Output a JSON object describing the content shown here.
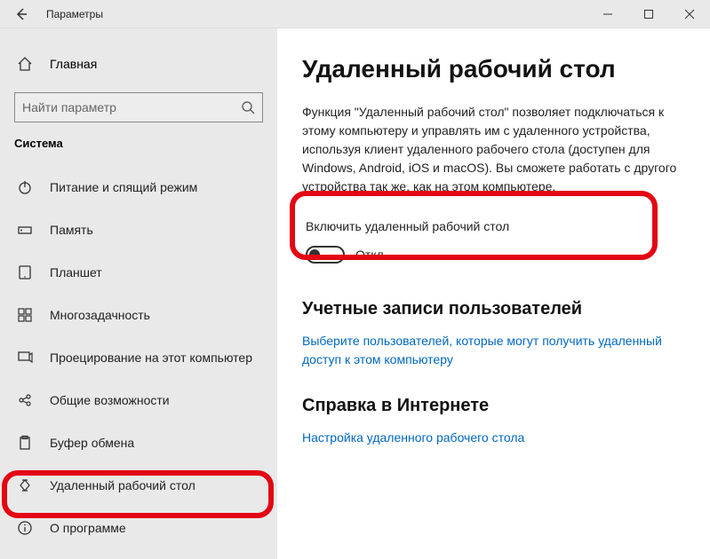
{
  "titlebar": {
    "title": "Параметры"
  },
  "sidebar": {
    "home_label": "Главная",
    "search_placeholder": "Найти параметр",
    "category_label": "Система",
    "items": [
      {
        "icon": "power-icon",
        "label": "Питание и спящий режим"
      },
      {
        "icon": "storage-icon",
        "label": "Память"
      },
      {
        "icon": "tablet-icon",
        "label": "Планшет"
      },
      {
        "icon": "multitask-icon",
        "label": "Многозадачность"
      },
      {
        "icon": "project-icon",
        "label": "Проецирование на этот компьютер"
      },
      {
        "icon": "shared-icon",
        "label": "Общие возможности"
      },
      {
        "icon": "clipboard-icon",
        "label": "Буфер обмена"
      },
      {
        "icon": "remote-icon",
        "label": "Удаленный рабочий стол"
      },
      {
        "icon": "about-icon",
        "label": "О программе"
      }
    ]
  },
  "content": {
    "heading": "Удаленный рабочий стол",
    "description": "Функция \"Удаленный рабочий стол\" позволяет подключаться к этому компьютеру и управлять им с удаленного устройства, используя клиент удаленного рабочего стола (доступен для Windows, Android, iOS и macOS). Вы сможете работать с другого устройства так же, как на этом компьютере.",
    "toggle_label": "Включить удаленный рабочий стол",
    "toggle_state": "Откл.",
    "accounts_heading": "Учетные записи пользователей",
    "accounts_link": "Выберите пользователей, которые могут получить удаленный доступ к этом компьютеру",
    "help_heading": "Справка в Интернете",
    "help_link": "Настройка удаленного рабочего стола"
  }
}
